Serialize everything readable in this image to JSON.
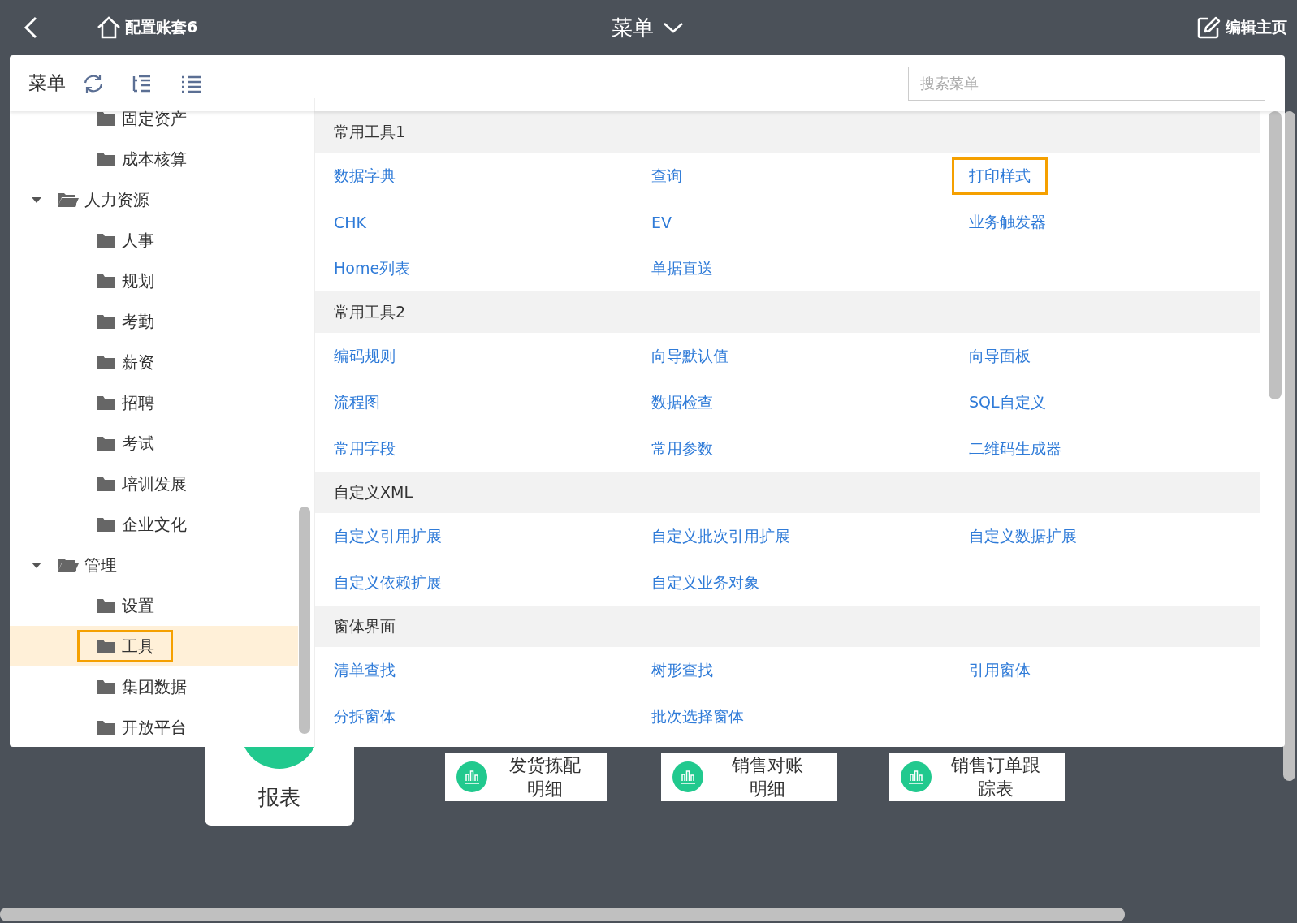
{
  "topbar": {
    "home": "配置账套6",
    "title": "菜单",
    "edit": "编辑主页"
  },
  "menu_panel": {
    "title": "菜单",
    "search": {
      "placeholder": "搜索菜单"
    },
    "tree": [
      {
        "label": "固定资产",
        "selected": false
      },
      {
        "label": "成本核算",
        "selected": false
      },
      {
        "label": "人力资源",
        "selected": false,
        "expanded": true,
        "children": [
          {
            "label": "人事",
            "selected": false
          },
          {
            "label": "规划",
            "selected": false
          },
          {
            "label": "考勤",
            "selected": false
          },
          {
            "label": "薪资",
            "selected": false
          },
          {
            "label": "招聘",
            "selected": false
          },
          {
            "label": "考试",
            "selected": false
          },
          {
            "label": "培训发展",
            "selected": false
          },
          {
            "label": "企业文化",
            "selected": false
          }
        ]
      },
      {
        "label": "管理",
        "selected": false,
        "expanded": true,
        "children": [
          {
            "label": "设置",
            "selected": false
          },
          {
            "label": "工具",
            "selected": true
          },
          {
            "label": "集团数据",
            "selected": false
          },
          {
            "label": "开放平台",
            "selected": false
          }
        ]
      }
    ],
    "sections": [
      {
        "title": "常用工具1",
        "links": [
          {
            "label": "数据字典",
            "highlighted": false
          },
          {
            "label": "查询",
            "highlighted": false
          },
          {
            "label": "打印样式",
            "highlighted": true
          },
          {
            "label": "CHK",
            "highlighted": false
          },
          {
            "label": "EV",
            "highlighted": false
          },
          {
            "label": "业务触发器",
            "highlighted": false
          },
          {
            "label": "Home列表",
            "highlighted": false
          },
          {
            "label": "单据直送",
            "highlighted": false
          }
        ]
      },
      {
        "title": "常用工具2",
        "links": [
          {
            "label": "编码规则",
            "highlighted": false
          },
          {
            "label": "向导默认值",
            "highlighted": false
          },
          {
            "label": "向导面板",
            "highlighted": false
          },
          {
            "label": "流程图",
            "highlighted": false
          },
          {
            "label": "数据检查",
            "highlighted": false
          },
          {
            "label": "SQL自定义",
            "highlighted": false
          },
          {
            "label": "常用字段",
            "highlighted": false
          },
          {
            "label": "常用参数",
            "highlighted": false
          },
          {
            "label": "二维码生成器",
            "highlighted": false
          }
        ]
      },
      {
        "title": "自定义XML",
        "links": [
          {
            "label": "自定义引用扩展",
            "highlighted": false
          },
          {
            "label": "自定义批次引用扩展",
            "highlighted": false
          },
          {
            "label": "自定义数据扩展",
            "highlighted": false
          },
          {
            "label": "自定义依赖扩展",
            "highlighted": false
          },
          {
            "label": "自定义业务对象",
            "highlighted": false
          }
        ]
      },
      {
        "title": "窗体界面",
        "links": [
          {
            "label": "清单查找",
            "highlighted": false
          },
          {
            "label": "树形查找",
            "highlighted": false
          },
          {
            "label": "引用窗体",
            "highlighted": false
          },
          {
            "label": "分拆窗体",
            "highlighted": false
          },
          {
            "label": "批次选择窗体",
            "highlighted": false
          }
        ]
      }
    ]
  },
  "dashboard": {
    "card": "报表",
    "tiles": [
      [
        "发货拣配",
        "明细"
      ],
      [
        "销售对账",
        "明细"
      ],
      [
        "销售订单跟",
        "踪表"
      ]
    ]
  }
}
